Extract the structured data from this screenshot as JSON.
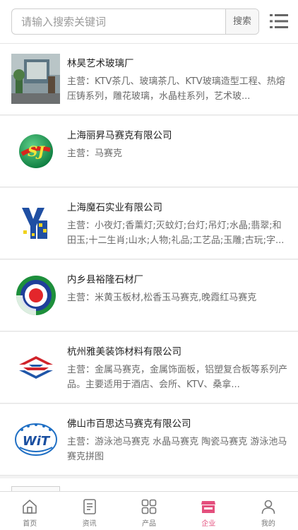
{
  "header": {
    "search_placeholder": "请输入搜索关键词",
    "search_button": "搜索"
  },
  "companies": [
    {
      "name": "林昊艺术玻璃厂",
      "desc": "主营：KTV茶几、玻璃茶几、KTV玻璃造型工程、热熔压铸系列，雕花玻璃，水晶柱系列，艺术玻..."
    },
    {
      "name": "上海丽昇马赛克有限公司",
      "desc": "主营：马赛克"
    },
    {
      "name": "上海魔石实业有限公司",
      "desc": "主营：小夜灯;香薰灯;灭蚊灯;台灯;吊灯;水晶;翡翠;和田玉;十二生肖;山水;人物;礼品;工艺品;玉雕;古玩;字..."
    },
    {
      "name": "内乡县裕隆石材厂",
      "desc": "主营：米黄玉板材,松香玉马赛克,晚霞红马赛克"
    },
    {
      "name": "杭州雅美装饰材料有限公司",
      "desc": "主营：金属马赛克，金属饰面板，铝塑复合板等系列产品。主要适用于酒店、会所、KTV、桑拿..."
    },
    {
      "name": "佛山市百思达马赛克有限公司",
      "desc": "主营：游泳池马赛克 水晶马赛克 陶瓷马赛克 游泳池马赛克拼图"
    }
  ],
  "logos": {
    "logo2_text": "SJ",
    "logo6_text": "WiT"
  },
  "tabs": [
    {
      "label": "首页",
      "icon": "home-icon"
    },
    {
      "label": "资讯",
      "icon": "news-icon"
    },
    {
      "label": "产品",
      "icon": "grid-icon"
    },
    {
      "label": "企业",
      "icon": "shop-icon"
    },
    {
      "label": "我的",
      "icon": "user-icon"
    }
  ],
  "colors": {
    "accent": "#e44f7d",
    "inactive": "#777777"
  }
}
